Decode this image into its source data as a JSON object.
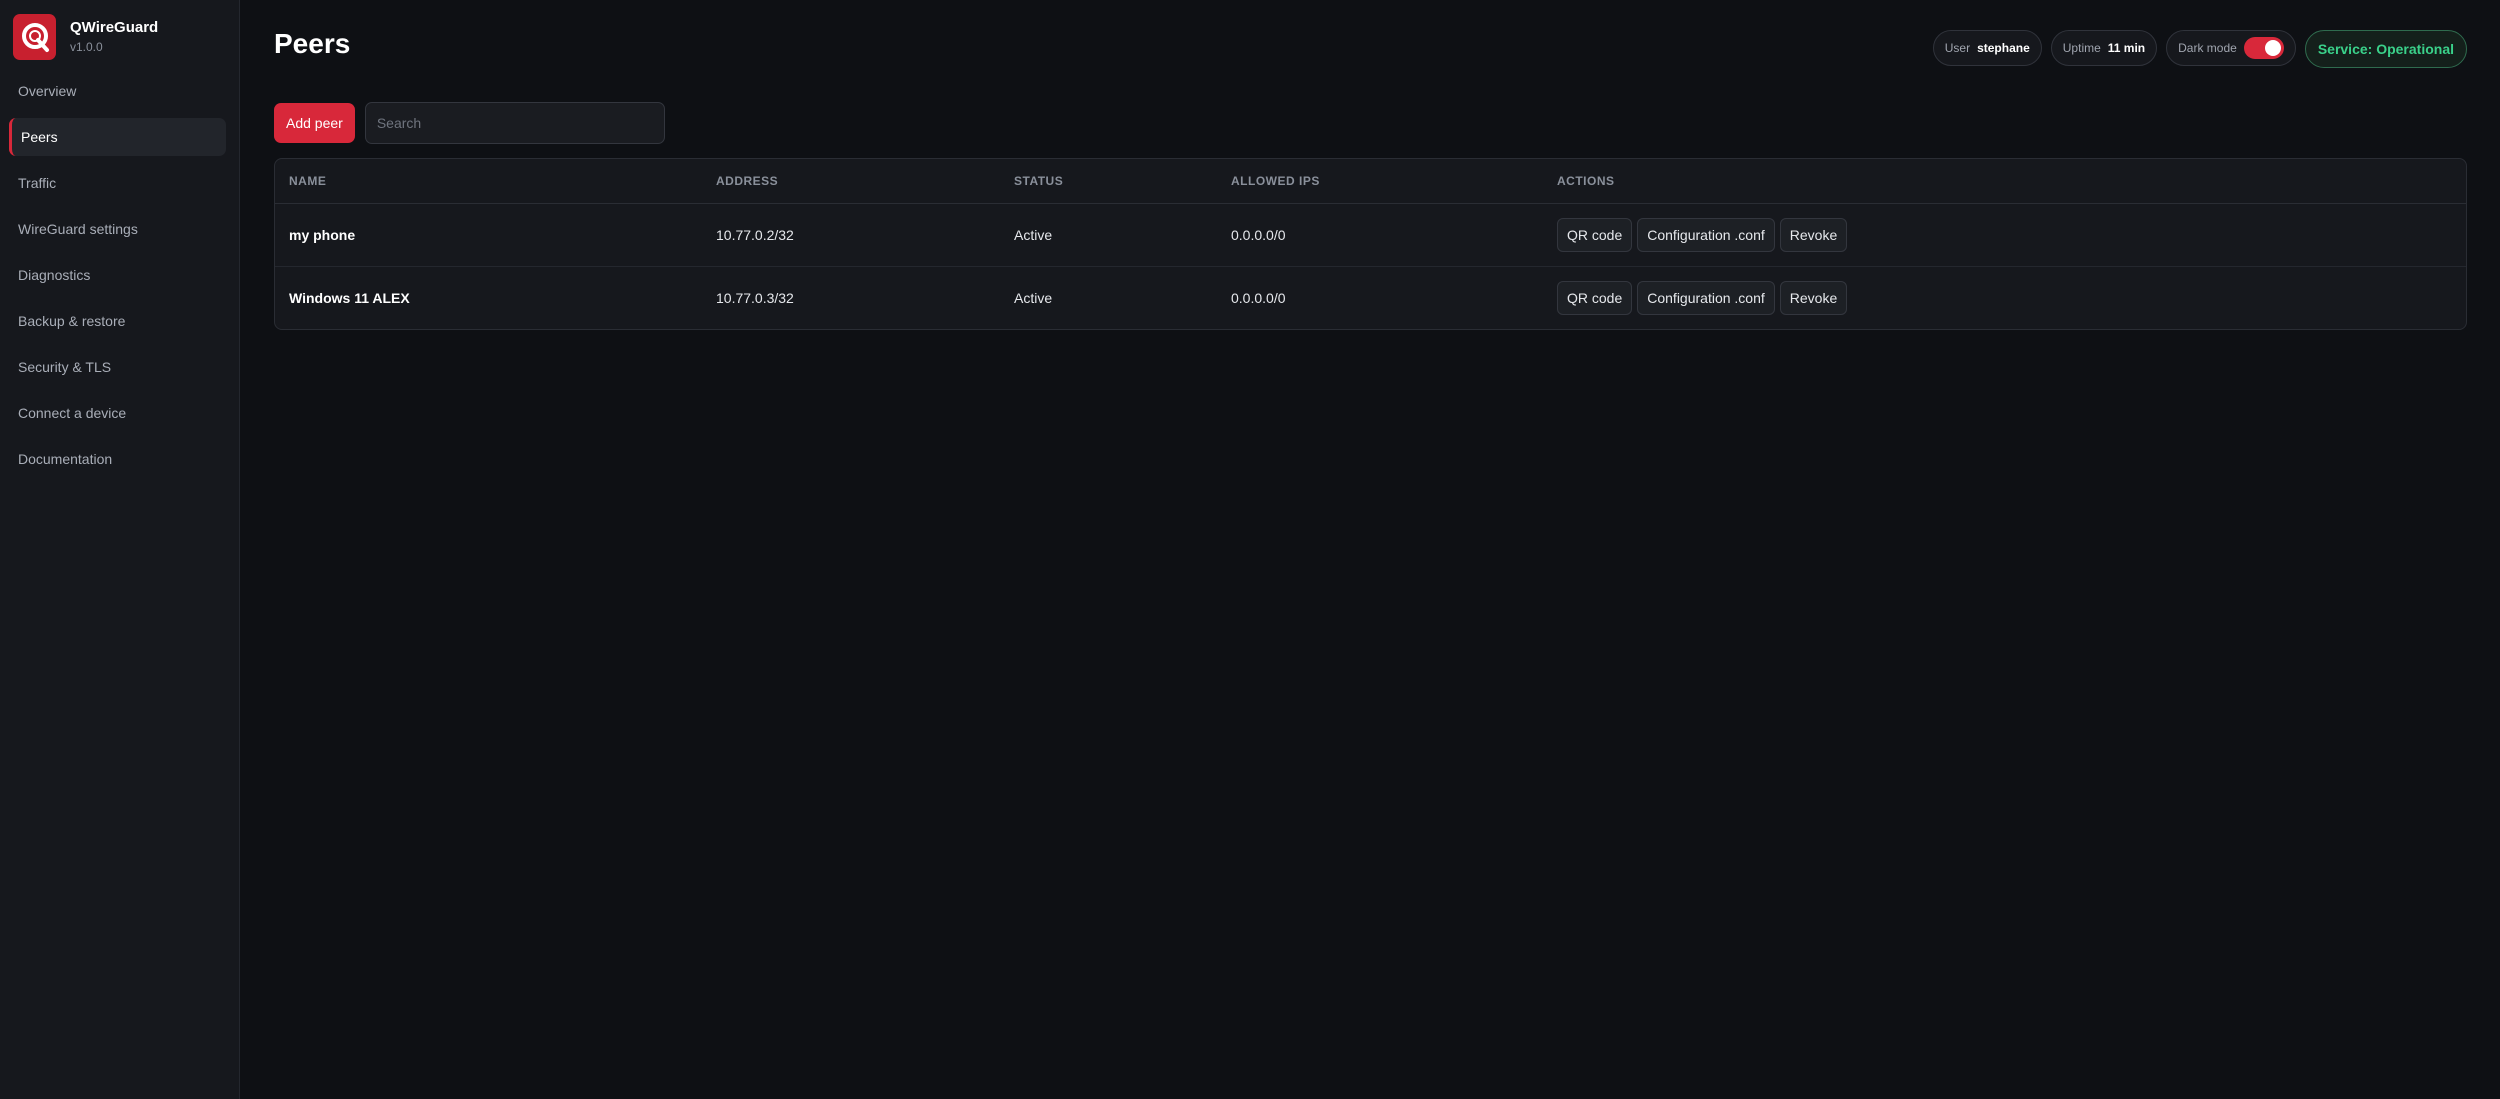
{
  "brand": {
    "name": "QWireGuard",
    "version": "v1.0.0",
    "accent": "#d8283a"
  },
  "sidebar": {
    "items": [
      {
        "label": "Overview",
        "active": false
      },
      {
        "label": "Peers",
        "active": true
      },
      {
        "label": "Traffic",
        "active": false
      },
      {
        "label": "WireGuard settings",
        "active": false
      },
      {
        "label": "Diagnostics",
        "active": false
      },
      {
        "label": "Backup & restore",
        "active": false
      },
      {
        "label": "Security & TLS",
        "active": false
      },
      {
        "label": "Connect a device",
        "active": false
      },
      {
        "label": "Documentation",
        "active": false
      }
    ]
  },
  "header": {
    "title": "Peers",
    "user_label": "User",
    "user_value": "stephane",
    "uptime_label": "Uptime",
    "uptime_value": "11 min",
    "dark_mode_label": "Dark mode",
    "dark_mode_on": true,
    "service_status": "Service: Operational",
    "status_color": "#3ad18a"
  },
  "toolbar": {
    "add_peer_label": "Add peer",
    "search_placeholder": "Search",
    "search_value": ""
  },
  "table": {
    "columns": [
      "NAME",
      "ADDRESS",
      "STATUS",
      "ALLOWED IPS",
      "ACTIONS"
    ],
    "rows": [
      {
        "name": "my phone",
        "address": "10.77.0.2/32",
        "status": "Active",
        "allowed_ips": "0.0.0.0/0"
      },
      {
        "name": "Windows 11 ALEX",
        "address": "10.77.0.3/32",
        "status": "Active",
        "allowed_ips": "0.0.0.0/0"
      }
    ],
    "actions": {
      "qr": "QR code",
      "config": "Configuration .conf",
      "revoke": "Revoke"
    }
  }
}
